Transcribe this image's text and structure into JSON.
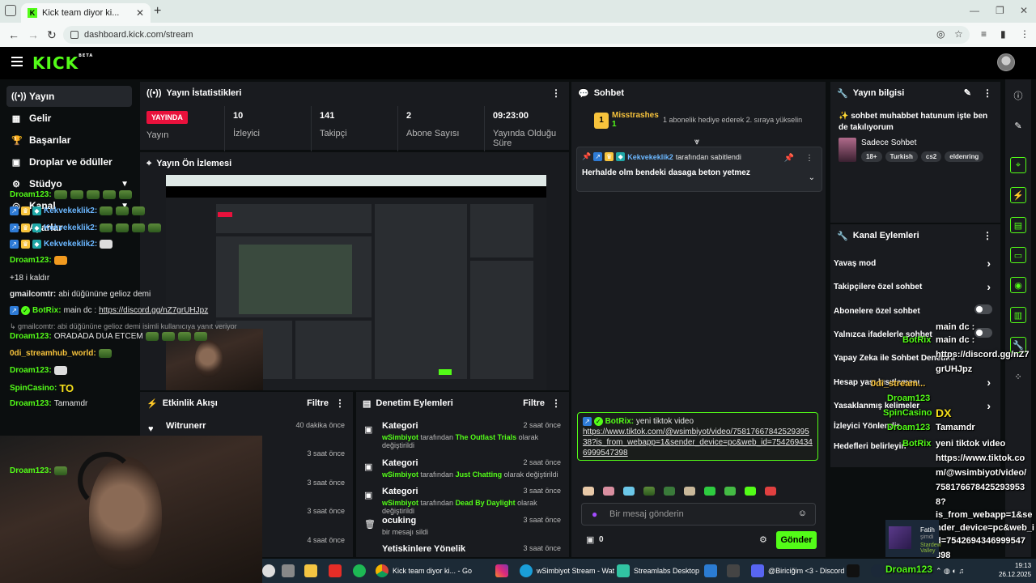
{
  "browser": {
    "tab_title": "Kick team diyor ki...",
    "tab_close": "✕",
    "new_tab": "+",
    "url": "dashboard.kick.com/stream",
    "back": "←",
    "forward": "→",
    "reload": "↻"
  },
  "kick": {
    "logo": "KICK",
    "logo_sup": "BETA"
  },
  "sidebar": {
    "items": [
      {
        "label": "Yayın",
        "icon": "((•))"
      },
      {
        "label": "Gelir",
        "icon": "▦"
      },
      {
        "label": "Başarılar",
        "icon": "🏆"
      },
      {
        "label": "Droplar ve ödüller",
        "icon": "▣"
      },
      {
        "label": "Stüdyo",
        "icon": "⚙"
      },
      {
        "label": "Kanal",
        "icon": "◎"
      },
      {
        "label": "Ayarlar",
        "icon": "⚙"
      }
    ]
  },
  "stats": {
    "title": "Yayın İstatistikleri",
    "live_badge": "YAYINDA",
    "live_label": "Yayın",
    "viewers_value": "10",
    "viewers_label": "İzleyici",
    "followers_value": "141",
    "followers_label": "Takipçi",
    "subs_value": "2",
    "subs_label": "Abone Sayısı",
    "duration_value": "09:23:00",
    "duration_label_1": "Yayında Olduğu",
    "duration_label_2": "Süre"
  },
  "preview": {
    "title": "Yayın Ön İzlemesi"
  },
  "activity": {
    "title": "Etkinlik Akışı",
    "filter": "Filtre",
    "rows": [
      {
        "name": "Witrunerr",
        "time": "40 dakika önce"
      },
      {
        "name": "",
        "time": "3 saat önce"
      },
      {
        "name": "",
        "time": "3 saat önce"
      },
      {
        "name": "",
        "time": "3 saat önce"
      },
      {
        "name": "",
        "time": "4 saat önce"
      }
    ]
  },
  "audit": {
    "title": "Denetim Eylemleri",
    "filter": "Filtre",
    "rows": [
      {
        "title": "Kategori",
        "time": "2 saat önce",
        "actor": "wSimbiyot",
        "mid": " tarafından ",
        "target": "The Outlast Trials",
        "tail": " olarak değiştirildi"
      },
      {
        "title": "Kategori",
        "time": "2 saat önce",
        "actor": "wSimbiyot",
        "mid": " tarafından ",
        "target": "Just Chatting",
        "tail": " olarak değiştirildi"
      },
      {
        "title": "Kategori",
        "time": "3 saat önce",
        "actor": "wSimbiyot",
        "mid": " tarafından ",
        "target": "Dead By Daylight",
        "tail": " olarak değiştirildi"
      },
      {
        "title": "ocuking",
        "time": "3 saat önce",
        "actor": "",
        "mid": "bir mesajı sildi",
        "target": "",
        "tail": ""
      },
      {
        "title": "Yetiskinlere Yönelik",
        "time": "3 saat önce",
        "actor": "",
        "mid": "",
        "target": "",
        "tail": ""
      }
    ]
  },
  "chat": {
    "title": "Sohbet",
    "gifter": "Misstrashes",
    "gifter_count": "1",
    "gift_note": "1 abonelik hediye ederek 2. sıraya yükselin",
    "pinned_by": "Kekvekeklik2",
    "pinned_suffix": " tarafından sabitlendi",
    "pinned_text": "Herhalde olm bendeki dasaga beton yetmez",
    "messages": {
      "m1_user": "Droam123:",
      "m2_user": "Kekvekeklik2:",
      "m3_user": "Kekvekeklik2:",
      "m4_user": "Kekvekeklik2:",
      "m5_user": "Droam123:",
      "m6_text": "+18 i kaldır",
      "m7_user": "gmailcomtr:",
      "m7_text": " abi düğününe gelioz demi",
      "m8_user": "BotRix:",
      "m8_text": " main dc : ",
      "m8_link": "https://discord.gg/nZ7grUHJpz",
      "m9_reply": "↳ gmailcomtr: abi düğününe gelioz demi isimli kullanıcıya yanıt veriyor",
      "m9_user": "Droam123:",
      "m9_text": " ORADADA DUA ETCEM",
      "m10_user": "0di_streamhub_world:",
      "m11_user": "Droam123:",
      "m12_user": "SpinCasino:",
      "m12_text": "TO",
      "m13_user": "Droam123:",
      "m13_text": " Tamamdr",
      "bot_user": "BotRix:",
      "bot_text": " yeni tiktok video",
      "bot_link": "https://www.tiktok.com/@wsimbiyot/video/7581766784252939538?is_from_webapp=1&sender_device=pc&web_id=7542694346999547398",
      "m15_user": "Droam123:"
    },
    "input_placeholder": "Bir mesaj gönderin",
    "points": "0",
    "send": "Gönder"
  },
  "info": {
    "title": "Yayın bilgisi",
    "stream_title": "✨ sohbet muhabbet hatunum işte ben de takılıyorum",
    "category": "Sadece Sohbet",
    "tags": [
      "18+",
      "Turkish",
      "cs2",
      "eldenring"
    ]
  },
  "actions": {
    "title": "Kanal Eylemleri",
    "rows": [
      {
        "label": "Yavaş mod",
        "kind": "chev"
      },
      {
        "label": "Takipçilere özel sohbet",
        "kind": "chev"
      },
      {
        "label": "Abonelere özel sohbet",
        "kind": "toggle"
      },
      {
        "label": "Yalnızca ifadelerle sohbet",
        "kind": "toggle"
      },
      {
        "label": "Yapay Zeka ile Sohbet Denetimi",
        "kind": "none"
      },
      {
        "label": "Hesap yaşı kısıtlaması",
        "kind": "chev"
      },
      {
        "label": "Yasaklanmış kelimeler",
        "kind": "chev"
      },
      {
        "label": "İzleyici Yönlendir",
        "kind": "none"
      },
      {
        "label": "Hedefleri belirleyin",
        "kind": "none"
      }
    ]
  },
  "overlay": {
    "lines": [
      "BotRix",
      "main dc :",
      "https://discord.gg/nZ7",
      "grUHJpz",
      "0di_stream...",
      "Droam123",
      "SpinCasino",
      "DX",
      "Droam123",
      "Tamamdr",
      "BotRix",
      "yeni tiktok video",
      "https://www.tiktok.co",
      "m/@wsimbiyot/video/",
      "758176678425293953",
      "8?",
      "is_from_webapp=1&se",
      "nder_device=pc&web_i",
      "d=7542694346999547",
      "398",
      "Droam123"
    ],
    "notif_name": "Fatih",
    "notif_sub": "şimdi",
    "notif_game": "Stardew Valley"
  },
  "taskbar": {
    "items": [
      "Kick team diyor ki... - Go",
      "wSimbiyot Stream - Wat",
      "Streamlabs Desktop",
      "@Biriciğim <3 - Discord"
    ],
    "time": "19:13",
    "date": "26.12.2025"
  },
  "colors": {
    "accent": "#53fc18",
    "live": "#e9113c",
    "panel": "#191b1f"
  }
}
